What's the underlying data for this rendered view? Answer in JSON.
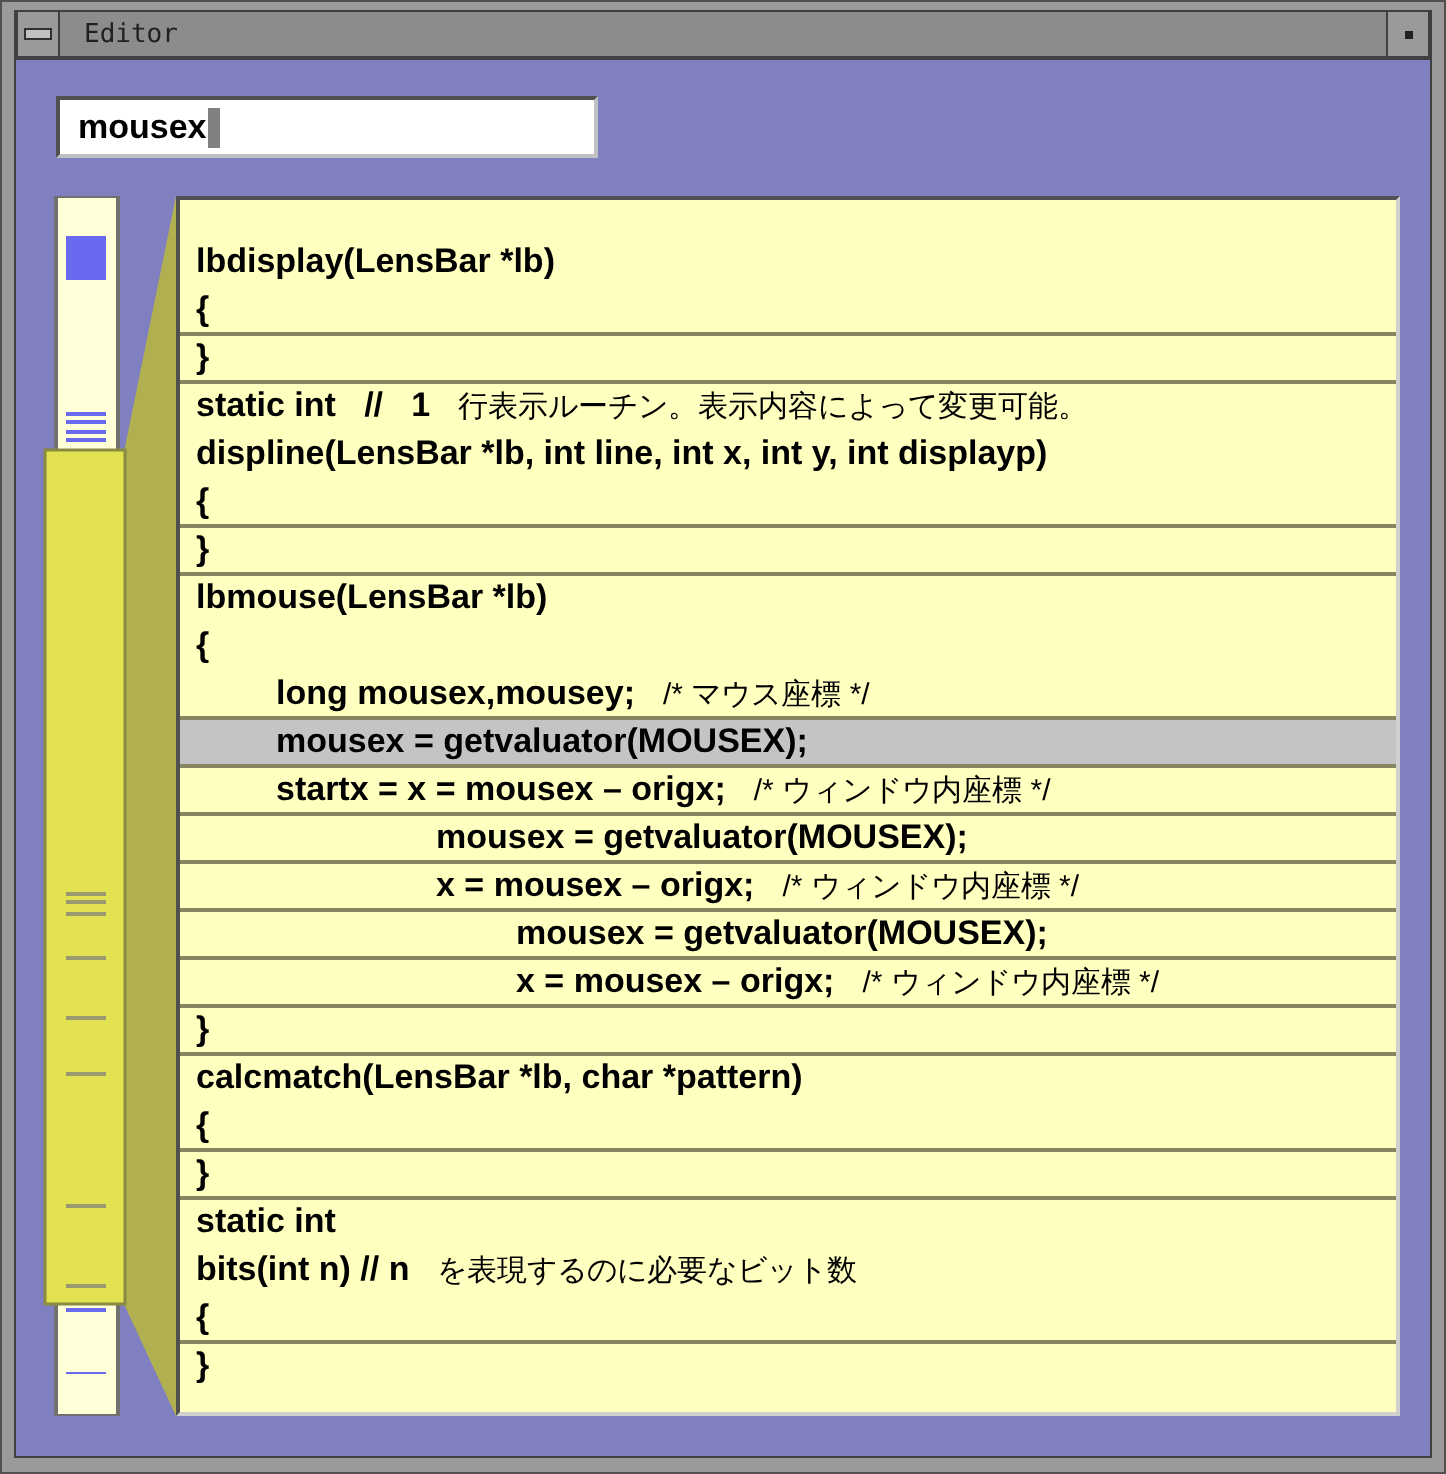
{
  "window": {
    "title": "Editor"
  },
  "search": {
    "value": "mousex"
  },
  "lines": [
    {
      "kind": "top",
      "code": "lbdisplay(LensBar *lb)",
      "selected": false,
      "rule_below": false
    },
    {
      "kind": "top",
      "code": "{",
      "selected": false,
      "rule_below": true
    },
    {
      "kind": "top",
      "code": "}",
      "selected": false,
      "rule_below": true
    },
    {
      "kind": "top",
      "code": "static int   //   1",
      "comment": "行表示ルーチン。表示内容によって変更可能。",
      "selected": false,
      "rule_below": false
    },
    {
      "kind": "top",
      "code": "displine(LensBar *lb, int line, int x, int y, int displayp)",
      "selected": false,
      "rule_below": false
    },
    {
      "kind": "top",
      "code": "{",
      "selected": false,
      "rule_below": true
    },
    {
      "kind": "top",
      "code": "}",
      "selected": false,
      "rule_below": true
    },
    {
      "kind": "top",
      "code": "lbmouse(LensBar *lb)",
      "selected": false,
      "rule_below": false
    },
    {
      "kind": "top",
      "code": "{",
      "selected": false,
      "rule_below": false
    },
    {
      "kind": "body",
      "code": "long mousex,mousey;",
      "comment": "/* マウス座標 */",
      "selected": false,
      "rule_below": true
    },
    {
      "kind": "body",
      "code": "mousex = getvaluator(MOUSEX);",
      "selected": true,
      "rule_below": true
    },
    {
      "kind": "body",
      "code": "startx = x = mousex – origx;",
      "comment": "/* ウィンドウ内座標 */",
      "selected": false,
      "rule_below": true
    },
    {
      "kind": "nested",
      "code": "mousex = getvaluator(MOUSEX);",
      "selected": false,
      "rule_below": true
    },
    {
      "kind": "nested",
      "code": "x = mousex – origx;",
      "comment": "/* ウィンドウ内座標 */",
      "selected": false,
      "rule_below": true
    },
    {
      "kind": "deep",
      "code": "mousex = getvaluator(MOUSEX);",
      "selected": false,
      "rule_below": true
    },
    {
      "kind": "deep",
      "code": "x = mousex – origx;",
      "comment": "/* ウィンドウ内座標 */",
      "selected": false,
      "rule_below": true
    },
    {
      "kind": "top",
      "code": "}",
      "selected": false,
      "rule_below": true
    },
    {
      "kind": "top",
      "code": "calcmatch(LensBar *lb, char *pattern)",
      "selected": false,
      "rule_below": false
    },
    {
      "kind": "top",
      "code": "{",
      "selected": false,
      "rule_below": true
    },
    {
      "kind": "top",
      "code": "}",
      "selected": false,
      "rule_below": true
    },
    {
      "kind": "top",
      "code": "static int",
      "selected": false,
      "rule_below": false
    },
    {
      "kind": "top",
      "code": "bits(int n) // n",
      "comment": "を表現するのに必要なビット数",
      "selected": false,
      "rule_below": false
    },
    {
      "kind": "top",
      "code": "{",
      "selected": false,
      "rule_below": true
    },
    {
      "kind": "top",
      "code": "}",
      "selected": false,
      "rule_below": false
    }
  ]
}
